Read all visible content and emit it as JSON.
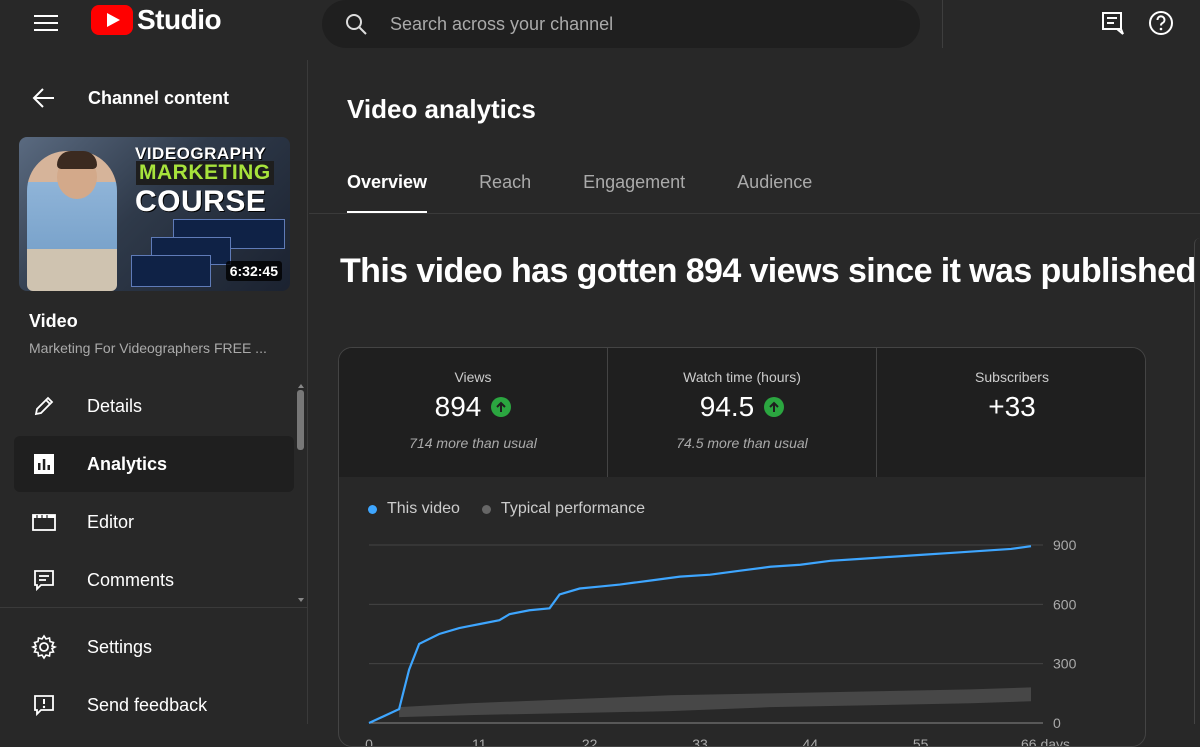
{
  "topbar": {
    "brand": "Studio",
    "search_placeholder": "Search across your channel"
  },
  "sidebar": {
    "back_label": "Channel content",
    "thumbnail": {
      "line1": "VIDEOGRAPHY",
      "line2": "MARKETING",
      "line3": "COURSE",
      "duration": "6:32:45"
    },
    "video_label": "Video",
    "video_title": "Marketing For Videographers FREE ...",
    "items": [
      {
        "label": "Details",
        "icon": "pencil-icon"
      },
      {
        "label": "Analytics",
        "icon": "analytics-icon",
        "active": true
      },
      {
        "label": "Editor",
        "icon": "editor-icon"
      },
      {
        "label": "Comments",
        "icon": "comments-icon"
      }
    ],
    "bottom_items": [
      {
        "label": "Settings",
        "icon": "gear-icon"
      },
      {
        "label": "Send feedback",
        "icon": "feedback-icon"
      }
    ]
  },
  "main": {
    "title": "Video analytics",
    "tabs": [
      {
        "label": "Overview",
        "active": true
      },
      {
        "label": "Reach"
      },
      {
        "label": "Engagement"
      },
      {
        "label": "Audience"
      }
    ],
    "headline": "This video has gotten 894 views since it was published",
    "metrics": [
      {
        "label": "Views",
        "value": "894",
        "up": true,
        "sub": "714 more than usual"
      },
      {
        "label": "Watch time (hours)",
        "value": "94.5",
        "up": true,
        "sub": "74.5 more than usual"
      },
      {
        "label": "Subscribers",
        "value": "+33",
        "up": false,
        "sub": ""
      }
    ]
  },
  "colors": {
    "this_video": "#3ea6ff",
    "typical": "#555555",
    "up_arrow": "#2ba640",
    "brand_red": "#ff0000"
  },
  "chart_data": {
    "type": "line",
    "legend": [
      "This video",
      "Typical performance"
    ],
    "x_ticks": [
      "0",
      "11",
      "22",
      "33",
      "44",
      "55",
      "66 days"
    ],
    "y_ticks": [
      "900",
      "600",
      "300",
      "0"
    ],
    "ylim": [
      0,
      900
    ],
    "xlim": [
      0,
      66
    ],
    "series": [
      {
        "name": "This video",
        "x": [
          0,
          3,
          4,
          5,
          7,
          9,
          10,
          11,
          13,
          14,
          16,
          18,
          19,
          21,
          23,
          25,
          28,
          31,
          34,
          37,
          40,
          43,
          46,
          49,
          52,
          55,
          58,
          61,
          64,
          66
        ],
        "y": [
          0,
          70,
          270,
          400,
          450,
          480,
          490,
          500,
          520,
          550,
          570,
          580,
          650,
          680,
          690,
          700,
          720,
          740,
          750,
          770,
          790,
          800,
          820,
          830,
          840,
          850,
          860,
          870,
          880,
          894
        ]
      },
      {
        "name": "Typical performance",
        "x": [
          3,
          10,
          20,
          30,
          40,
          50,
          60,
          66
        ],
        "y_low": [
          30,
          40,
          50,
          60,
          80,
          90,
          100,
          110
        ],
        "y_high": [
          80,
          100,
          120,
          140,
          150,
          160,
          170,
          180
        ]
      }
    ]
  }
}
